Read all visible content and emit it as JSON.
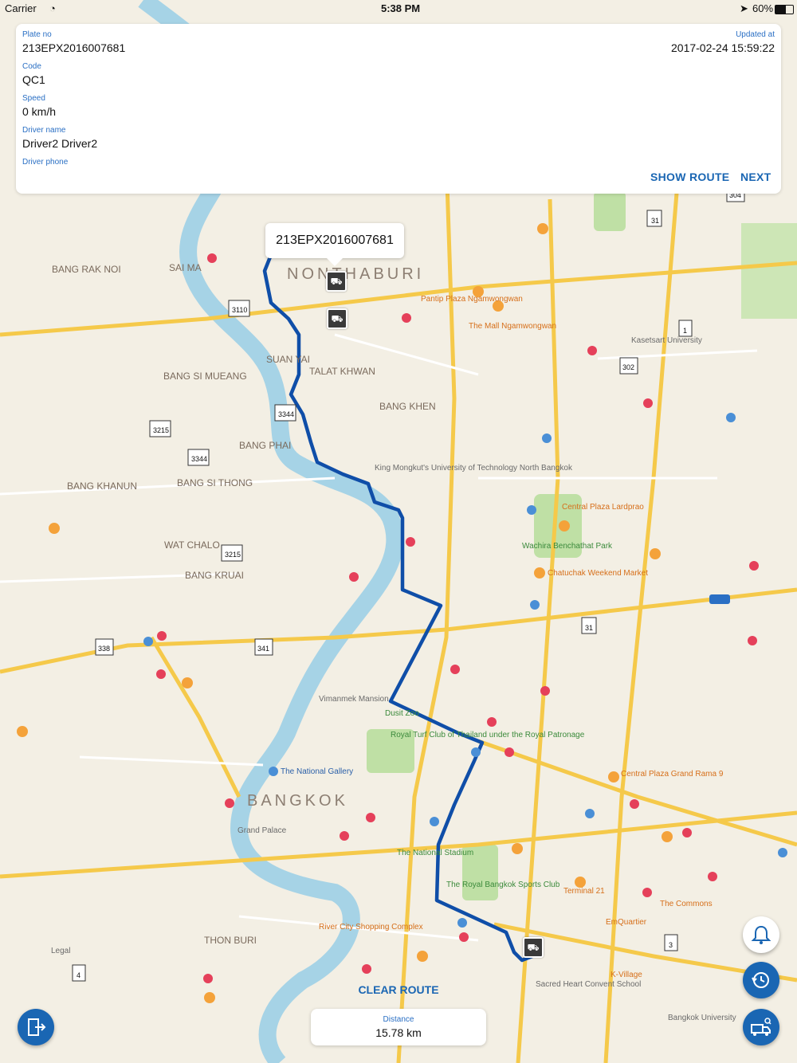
{
  "status_bar": {
    "carrier": "Carrier",
    "time": "5:38 PM",
    "battery": "60%"
  },
  "vehicle_card": {
    "plate_label": "Plate no",
    "plate_value": "213EPX2016007681",
    "updated_label": "Updated at",
    "updated_value": "2017-02-24 15:59:22",
    "code_label": "Code",
    "code_value": "QC1",
    "speed_label": "Speed",
    "speed_value": "0 km/h",
    "driver_name_label": "Driver name",
    "driver_name_value": "Driver2 Driver2",
    "driver_phone_label": "Driver phone",
    "show_route_label": "SHOW ROUTE",
    "next_label": "NEXT"
  },
  "map": {
    "callout_text": "213EPX2016007681",
    "labels": {
      "nonthaburi": "NONTHABURI",
      "bangkok": "BANGKOK",
      "bang_rak_noi": "BANG RAK NOI",
      "sai_ma": "SAI MA",
      "suan_yai": "SUAN YAI",
      "talat_khwan": "TALAT KHWAN",
      "bang_si_mueang": "BANG SI MUEANG",
      "bang_khen": "BANG KHEN",
      "bang_phai": "BANG PHAI",
      "bang_khanun": "BANG KHANUN",
      "bang_si_thong": "BANG SI THONG",
      "wat_chalo": "WAT CHALO",
      "bang_kruai": "BANG KRUAI",
      "thon_buri": "THON BURI",
      "wachira": "Wachira Benchathat Park",
      "pantip": "Pantip Plaza Ngamwongwan",
      "mall_ngam": "The Mall Ngamwongwan",
      "kasetsart": "Kasetsart University",
      "chatuchak": "Chatuchak Weekend Market",
      "central_lardprao": "Central Plaza Lardprao",
      "dusit_zoo": "Dusit Zoo",
      "national_gallery": "The National Gallery",
      "grand_palace": "Grand Palace",
      "national_stadium": "The National Stadium",
      "royal_bangkok": "The Royal Bangkok Sports Club",
      "terminal21": "Terminal 21",
      "sacred_heart": "Sacred Heart Convent School",
      "bangkok_university": "Bangkok University",
      "central_rama9": "Central Plaza Grand Rama 9",
      "the_commons": "The Commons",
      "k_village": "K-Village",
      "emquartier": "EmQuartier",
      "icon_siam": "River City Shopping Complex",
      "king_mongkut": "King Mongkut's University of Technology North Bangkok",
      "vimanmek": "Vimanmek Mansion",
      "royal_turf": "Royal Turf Club of Thailand under the Royal Patronage",
      "legal": "Legal"
    }
  },
  "bottom": {
    "clear_route_label": "CLEAR ROUTE",
    "distance_label": "Distance",
    "distance_value": "15.78 km"
  },
  "colors": {
    "accent": "#1a66b3",
    "route": "#0f4ea8",
    "river": "#a6d3e6"
  }
}
